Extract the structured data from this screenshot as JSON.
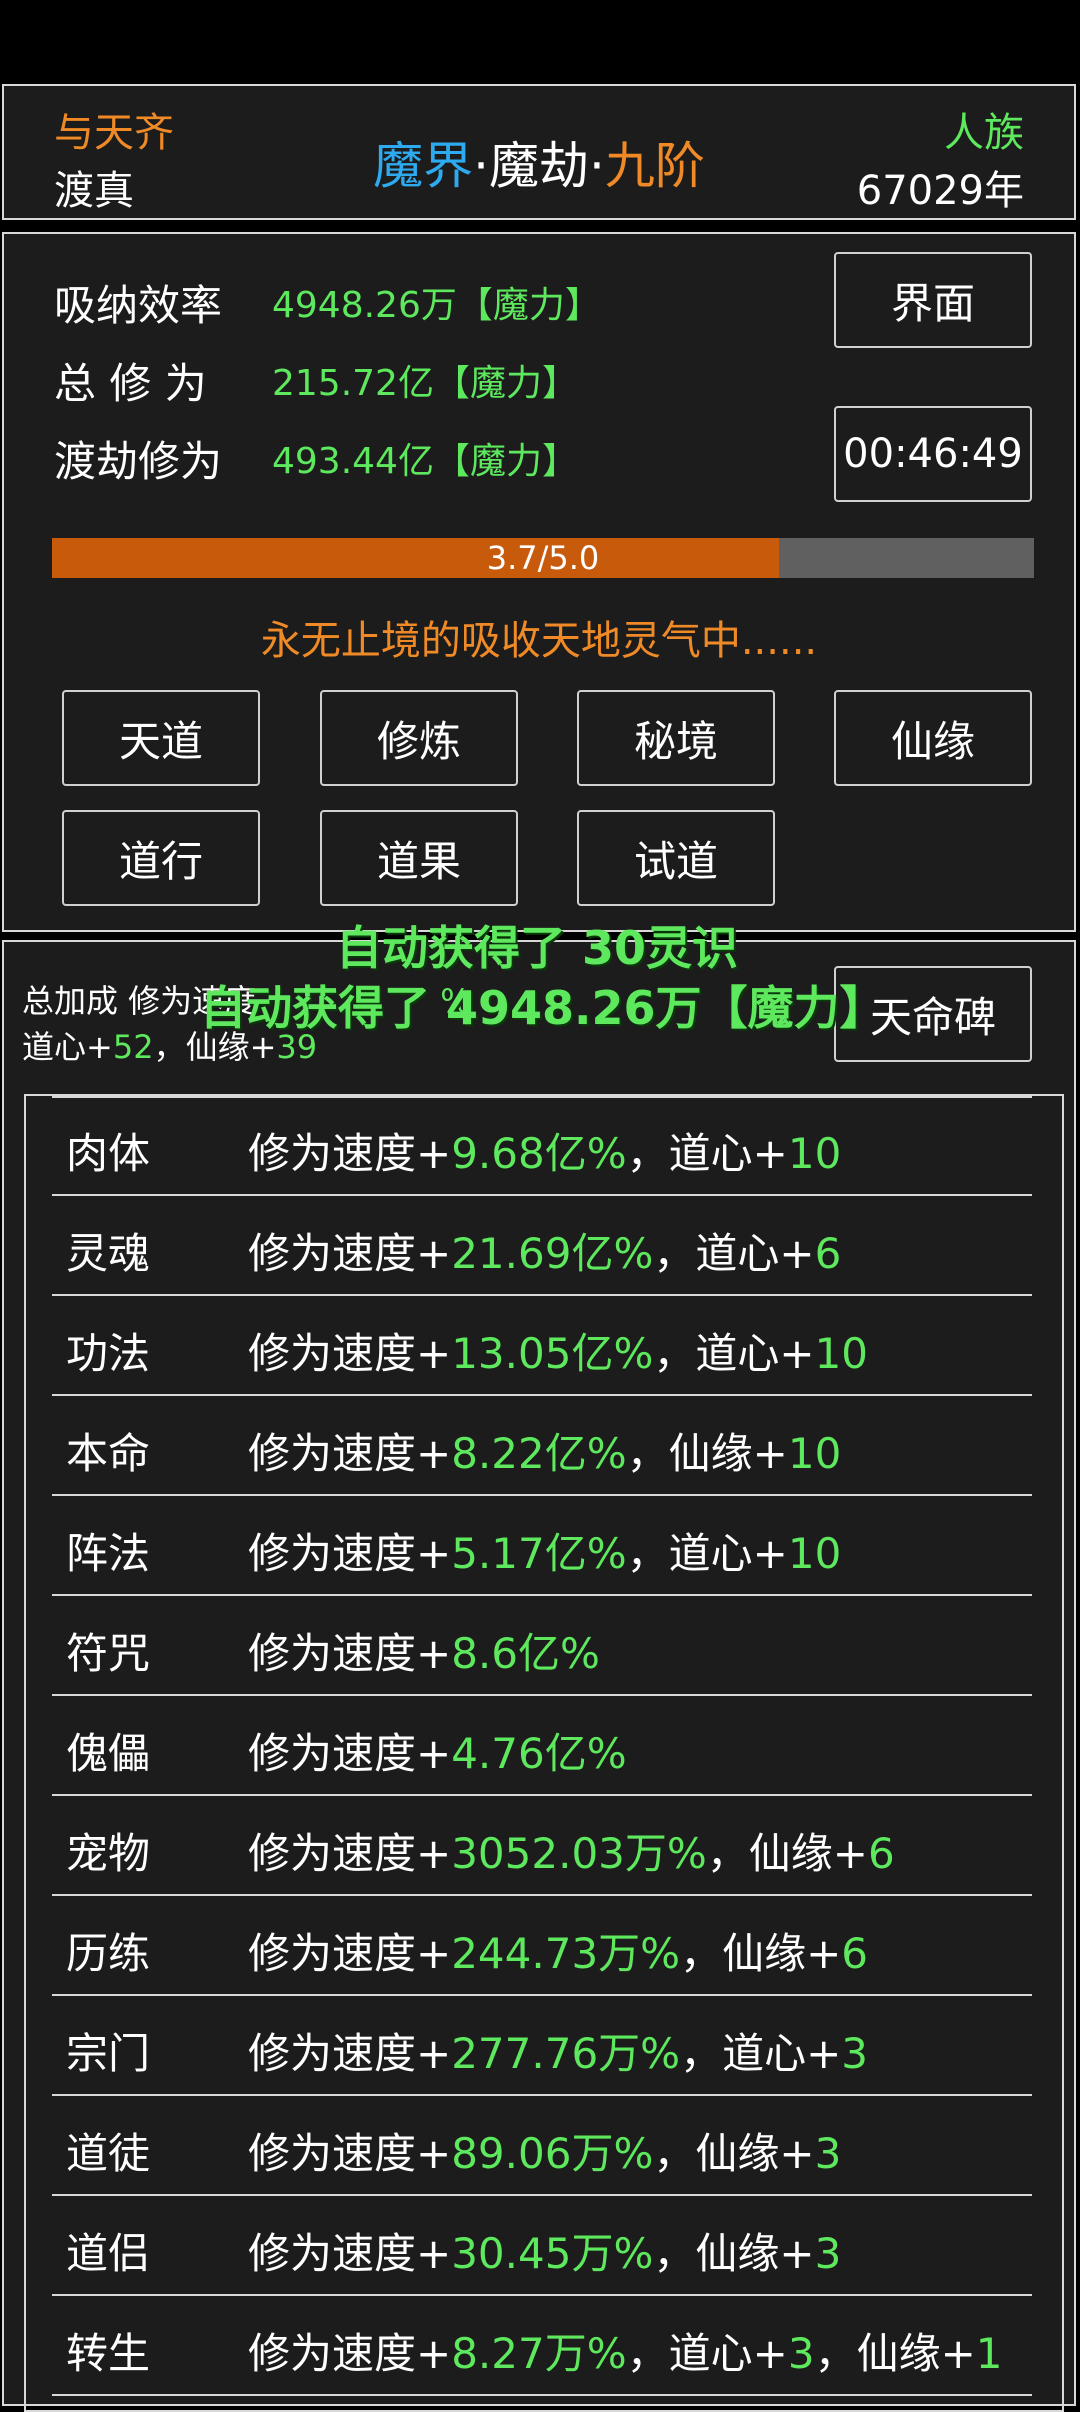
{
  "header": {
    "top_left_title": "与天齐",
    "top_left_sub": "渡真",
    "realm_part1": "魔界",
    "realm_sep1": "·",
    "realm_part2": "魔劫",
    "realm_sep2": "·",
    "realm_part3": "九阶",
    "race": "人族",
    "years": "67029年"
  },
  "stats": {
    "rows": [
      {
        "label": "吸纳效率",
        "value": "4948.26万【魔力】"
      },
      {
        "label": "总 修 为",
        "value": "215.72亿【魔力】"
      },
      {
        "label": "渡劫修为",
        "value": "493.44亿【魔力】"
      }
    ],
    "interface_button": "界面",
    "timer": "00:46:49",
    "progress": {
      "label": "3.7/5.0",
      "current": 3.7,
      "max": 5.0
    },
    "status_text": "永无止境的吸收天地灵气中......",
    "buttons": [
      "天道",
      "修炼",
      "秘境",
      "仙缘",
      "道行",
      "道果",
      "试道"
    ]
  },
  "bonus": {
    "summary_prefix": "总加成 修为速度",
    "summary_tail": "%",
    "line2_a_label": "道心+",
    "line2_a_value": "52",
    "line2_sep": "，",
    "line2_b_label": "仙缘+",
    "line2_b_value": "39",
    "destiny_button": "天命碑",
    "toasts": [
      "自动获得了 30灵识",
      "自动获得了 4948.26万【魔力】"
    ],
    "rows": [
      {
        "name": "肉体",
        "parts": [
          {
            "t": "修为速度+",
            "c": "w"
          },
          {
            "t": "9.68亿%",
            "c": "g"
          },
          {
            "t": "，道心+",
            "c": "w"
          },
          {
            "t": "10",
            "c": "g"
          }
        ]
      },
      {
        "name": "灵魂",
        "parts": [
          {
            "t": "修为速度+",
            "c": "w"
          },
          {
            "t": "21.69亿%",
            "c": "g"
          },
          {
            "t": "，道心+",
            "c": "w"
          },
          {
            "t": "6",
            "c": "g"
          }
        ]
      },
      {
        "name": "功法",
        "parts": [
          {
            "t": "修为速度+",
            "c": "w"
          },
          {
            "t": "13.05亿%",
            "c": "g"
          },
          {
            "t": "，道心+",
            "c": "w"
          },
          {
            "t": "10",
            "c": "g"
          }
        ]
      },
      {
        "name": "本命",
        "parts": [
          {
            "t": "修为速度+",
            "c": "w"
          },
          {
            "t": "8.22亿%",
            "c": "g"
          },
          {
            "t": "，仙缘+",
            "c": "w"
          },
          {
            "t": "10",
            "c": "g"
          }
        ]
      },
      {
        "name": "阵法",
        "parts": [
          {
            "t": "修为速度+",
            "c": "w"
          },
          {
            "t": "5.17亿%",
            "c": "g"
          },
          {
            "t": "，道心+",
            "c": "w"
          },
          {
            "t": "10",
            "c": "g"
          }
        ]
      },
      {
        "name": "符咒",
        "parts": [
          {
            "t": "修为速度+",
            "c": "w"
          },
          {
            "t": "8.6亿%",
            "c": "g"
          }
        ]
      },
      {
        "name": "傀儡",
        "parts": [
          {
            "t": "修为速度+",
            "c": "w"
          },
          {
            "t": "4.76亿%",
            "c": "g"
          }
        ]
      },
      {
        "name": "宠物",
        "parts": [
          {
            "t": "修为速度+",
            "c": "w"
          },
          {
            "t": "3052.03万%",
            "c": "g"
          },
          {
            "t": "，仙缘+",
            "c": "w"
          },
          {
            "t": "6",
            "c": "g"
          }
        ]
      },
      {
        "name": "历练",
        "parts": [
          {
            "t": "修为速度+",
            "c": "w"
          },
          {
            "t": "244.73万%",
            "c": "g"
          },
          {
            "t": "，仙缘+",
            "c": "w"
          },
          {
            "t": "6",
            "c": "g"
          }
        ]
      },
      {
        "name": "宗门",
        "parts": [
          {
            "t": "修为速度+",
            "c": "w"
          },
          {
            "t": "277.76万%",
            "c": "g"
          },
          {
            "t": "，道心+",
            "c": "w"
          },
          {
            "t": "3",
            "c": "g"
          }
        ]
      },
      {
        "name": "道徒",
        "parts": [
          {
            "t": "修为速度+",
            "c": "w"
          },
          {
            "t": "89.06万%",
            "c": "g"
          },
          {
            "t": "，仙缘+",
            "c": "w"
          },
          {
            "t": "3",
            "c": "g"
          }
        ]
      },
      {
        "name": "道侣",
        "parts": [
          {
            "t": "修为速度+",
            "c": "w"
          },
          {
            "t": "30.45万%",
            "c": "g"
          },
          {
            "t": "，仙缘+",
            "c": "w"
          },
          {
            "t": "3",
            "c": "g"
          }
        ]
      },
      {
        "name": "转生",
        "parts": [
          {
            "t": "修为速度+",
            "c": "w"
          },
          {
            "t": "8.27万%",
            "c": "g"
          },
          {
            "t": "，道心+",
            "c": "w"
          },
          {
            "t": "3",
            "c": "g"
          },
          {
            "t": "，仙缘+",
            "c": "w"
          },
          {
            "t": "1",
            "c": "g"
          }
        ]
      }
    ]
  },
  "colors": {
    "green": "#5ee85e",
    "orange": "#ef8a26",
    "blue": "#2eaaf0",
    "progress_fill": "#c85a0c",
    "progress_track": "#606060",
    "panel_bg": "#1c1c1c"
  }
}
